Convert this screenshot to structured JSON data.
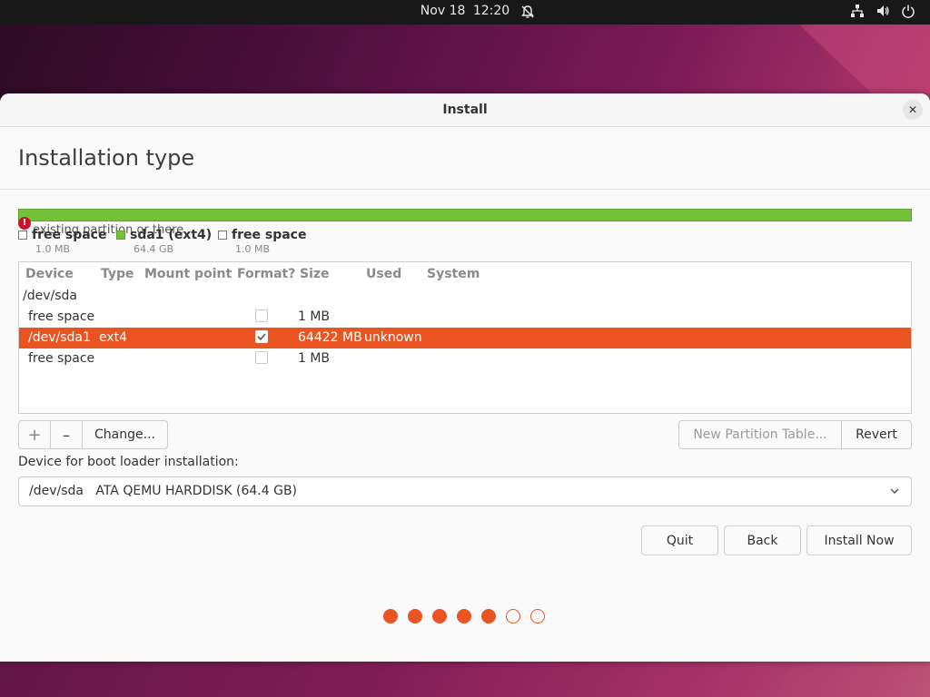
{
  "topbar": {
    "date": "Nov 18",
    "time": "12:20"
  },
  "window": {
    "title": "Install",
    "heading": "Installation type"
  },
  "disk_bar": {
    "overlay_text": "existing partition or there",
    "legend": [
      {
        "name": "free space",
        "size": "1.0 MB",
        "color": "#ffffff"
      },
      {
        "name": "sda1 (ext4)",
        "size": "64.4 GB",
        "color": "#73c23a"
      },
      {
        "name": "free space",
        "size": "1.0 MB",
        "color": "#ffffff"
      }
    ]
  },
  "table": {
    "columns": [
      "Device",
      "Type",
      "Mount point",
      "Format?",
      "Size",
      "Used",
      "System"
    ],
    "group": "/dev/sda",
    "rows": [
      {
        "device": "free space",
        "type": "",
        "size": "1 MB",
        "used": "",
        "format_checked": false,
        "selected": false
      },
      {
        "device": "/dev/sda1",
        "type": "ext4",
        "size": "64422 MB",
        "used": "unknown",
        "format_checked": true,
        "selected": true
      },
      {
        "device": "free space",
        "type": "",
        "size": "1 MB",
        "used": "",
        "format_checked": false,
        "selected": false
      }
    ]
  },
  "buttons": {
    "add": "+",
    "remove": "–",
    "change": "Change...",
    "new_table": "New Partition Table...",
    "revert": "Revert",
    "quit": "Quit",
    "back": "Back",
    "install": "Install Now"
  },
  "bootloader": {
    "label": "Device for boot loader installation:",
    "device": "/dev/sda",
    "description": "ATA QEMU HARDDISK (64.4 GB)"
  },
  "progress": {
    "total_steps": 7,
    "completed_steps": 5
  },
  "colors": {
    "accent": "#e95420",
    "partition_ext4": "#73c23a"
  }
}
